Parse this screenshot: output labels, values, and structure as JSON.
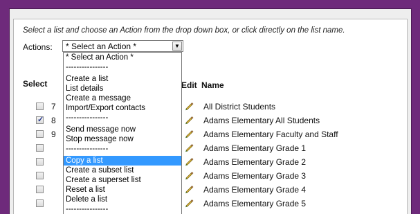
{
  "page": {
    "instructions": "Select a list and choose an Action from the drop down box, or click directly on the list name."
  },
  "actions": {
    "label": "Actions:",
    "selected_value": "* Select an Action *",
    "options": [
      "* Select an Action *",
      "----------------",
      "Create a list",
      "List details",
      "Create a message",
      "Import/Export contacts",
      "----------------",
      "Send message now",
      "Stop message now",
      "----------------",
      "Copy a list",
      "Create a subset list",
      "Create a superset list",
      "Reset a list",
      "Delete a list",
      "----------------"
    ],
    "highlighted_option": "Copy a list"
  },
  "table": {
    "headers": {
      "select": "Select",
      "edit": "Edit",
      "name": "Name"
    },
    "rows": [
      {
        "checked": false,
        "name": "All District Students",
        "frag": "7"
      },
      {
        "checked": true,
        "name": "Adams Elementary All Students",
        "frag": "8"
      },
      {
        "checked": false,
        "name": "Adams Elementary Faculty and Staff",
        "frag": "9"
      },
      {
        "checked": false,
        "name": "Adams Elementary Grade 1",
        "frag": ""
      },
      {
        "checked": false,
        "name": "Adams Elementary Grade 2",
        "frag": ""
      },
      {
        "checked": false,
        "name": "Adams Elementary Grade 3",
        "frag": ""
      },
      {
        "checked": false,
        "name": "Adams Elementary Grade 4",
        "frag": ""
      },
      {
        "checked": false,
        "name": "Adams Elementary Grade 5",
        "frag": ""
      }
    ]
  },
  "icons": {
    "edit": "pencil-icon",
    "dropdown": "chevron-down-icon"
  },
  "colors": {
    "border": "#6e2a7b",
    "highlight": "#3399ff"
  }
}
